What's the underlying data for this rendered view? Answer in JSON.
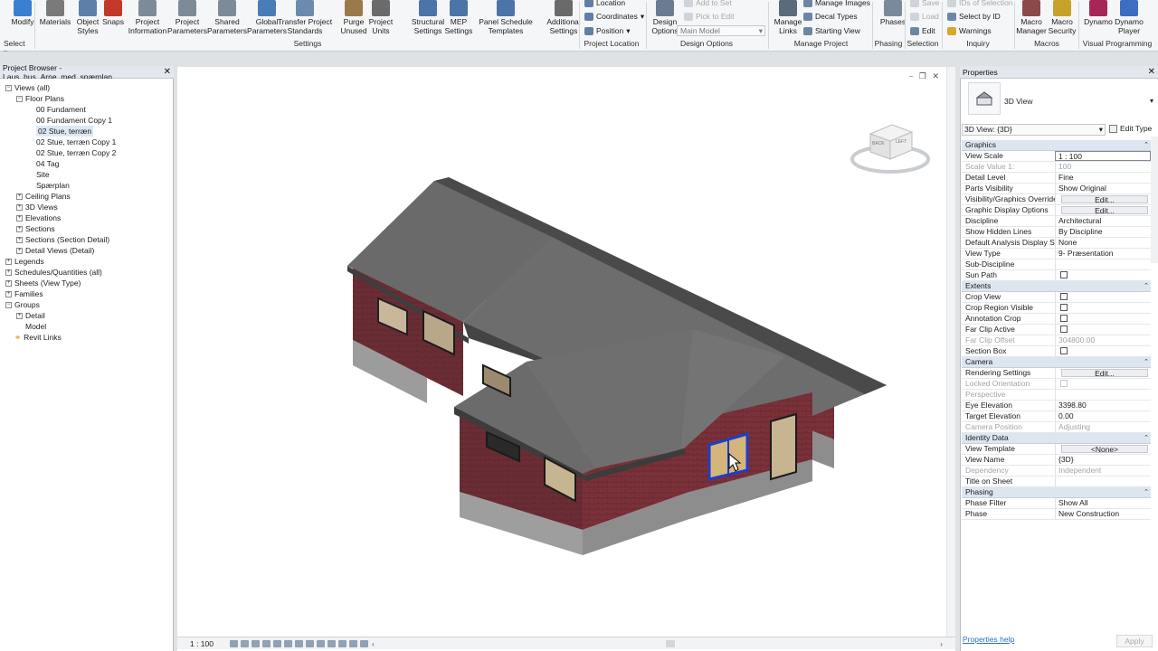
{
  "ribbon": {
    "buttons": [
      {
        "label": "Modify",
        "name": "modify-button",
        "icon": "cursor-icon",
        "color": "#3b7fd0"
      },
      {
        "label": "Materials",
        "name": "materials-button",
        "icon": "sphere-icon",
        "color": "#7a7a7a"
      },
      {
        "label": "Object Styles",
        "name": "object-styles-button",
        "icon": "object-styles-icon",
        "color": "#5d7fa8"
      },
      {
        "label": "Snaps",
        "name": "snaps-button",
        "icon": "magnet-icon",
        "color": "#c2392b"
      },
      {
        "label": "Project Information",
        "name": "project-information-button",
        "icon": "building-doc-icon",
        "color": "#7d8b99"
      },
      {
        "label": "Project Parameters",
        "name": "project-parameters-button",
        "icon": "parameters-icon",
        "color": "#7d8b99"
      },
      {
        "label": "Shared Parameters",
        "name": "shared-parameters-button",
        "icon": "shared-params-icon",
        "color": "#7d8b99"
      },
      {
        "label": "Global Parameters",
        "name": "global-parameters-button",
        "icon": "globe-icon",
        "color": "#4a7db8"
      },
      {
        "label": "Transfer Project Standards",
        "name": "transfer-standards-button",
        "icon": "transfer-icon",
        "color": "#6c8aad"
      },
      {
        "label": "Purge Unused",
        "name": "purge-unused-button",
        "icon": "purge-icon",
        "color": "#9a7a4a"
      },
      {
        "label": "Project Units",
        "name": "project-units-button",
        "icon": "units-icon",
        "color": "#6b6b6b"
      },
      {
        "label": "Structural Settings",
        "name": "structural-settings-button",
        "icon": "structural-icon",
        "color": "#4b74a8"
      },
      {
        "label": "MEP Settings",
        "name": "mep-settings-button",
        "icon": "mep-icon",
        "color": "#4b74a8"
      },
      {
        "label": "Panel Schedule Templates",
        "name": "panel-schedule-button",
        "icon": "panel-schedule-icon",
        "color": "#4b74a8"
      },
      {
        "label": "Additional Settings",
        "name": "additional-settings-button",
        "icon": "wrench-icon",
        "color": "#6a6a6a"
      },
      {
        "label": "Design Options",
        "name": "design-options-button",
        "icon": "design-options-icon",
        "color": "#6a7c90"
      },
      {
        "label": "Manage Links",
        "name": "manage-links-button",
        "icon": "link-icon",
        "color": "#5a6b7c"
      },
      {
        "label": "Phases",
        "name": "phases-button",
        "icon": "phases-icon",
        "color": "#7a8a9a"
      },
      {
        "label": "Macro Manager",
        "name": "macro-manager-button",
        "icon": "macro-icon",
        "color": "#8a4a4a"
      },
      {
        "label": "Macro Security",
        "name": "macro-security-button",
        "icon": "shield-icon",
        "color": "#c7a12a"
      },
      {
        "label": "Dynamo",
        "name": "dynamo-button",
        "icon": "dynamo-icon",
        "color": "#a8255a"
      },
      {
        "label": "Dynamo Player",
        "name": "dynamo-player-button",
        "icon": "dynamo-player-icon",
        "color": "#3d6ec0"
      }
    ],
    "small": {
      "location": "Location",
      "coordinates": "Coordinates",
      "position": "Position",
      "main_model": "Main Model",
      "add_to_set": "Add to Set",
      "pick_to_edit": "Pick to Edit",
      "manage_images": "Manage Images",
      "decal_types": "Decal Types",
      "starting_view": "Starting View",
      "save": "Save",
      "load": "Load",
      "edit": "Edit",
      "ids_of_selection": "IDs of Selection",
      "select_by_id": "Select by ID",
      "warnings": "Warnings"
    },
    "groups": {
      "select": "Select",
      "settings": "Settings",
      "project_location": "Project Location",
      "design_options": "Design Options",
      "manage_project": "Manage Project",
      "phasing": "Phasing",
      "selection": "Selection",
      "inquiry": "Inquiry",
      "macros": "Macros",
      "visual_programming": "Visual Programming"
    }
  },
  "project_browser": {
    "title": "Project Browser - Laus_hus_Arne_med_spærplan_...",
    "close": "✕",
    "items": [
      {
        "label": "Views (all)",
        "level": 0,
        "toggle": "−"
      },
      {
        "label": "Floor Plans",
        "level": 1,
        "toggle": "−"
      },
      {
        "label": "00 Fundament",
        "level": 2,
        "toggle": ""
      },
      {
        "label": "00 Fundament Copy 1",
        "level": 2,
        "toggle": ""
      },
      {
        "label": "02 Stue, terræn",
        "level": 2,
        "toggle": "",
        "selected": true
      },
      {
        "label": "02 Stue, terræn Copy 1",
        "level": 2,
        "toggle": ""
      },
      {
        "label": "02 Stue, terræn Copy 2",
        "level": 2,
        "toggle": ""
      },
      {
        "label": "04 Tag",
        "level": 2,
        "toggle": ""
      },
      {
        "label": "Site",
        "level": 2,
        "toggle": ""
      },
      {
        "label": "Spærplan",
        "level": 2,
        "toggle": ""
      },
      {
        "label": "Ceiling Plans",
        "level": 1,
        "toggle": "+"
      },
      {
        "label": "3D Views",
        "level": 1,
        "toggle": "+"
      },
      {
        "label": "Elevations",
        "level": 1,
        "toggle": "+"
      },
      {
        "label": "Sections",
        "level": 1,
        "toggle": "+"
      },
      {
        "label": "Sections (Section Detail)",
        "level": 1,
        "toggle": "+"
      },
      {
        "label": "Detail Views (Detail)",
        "level": 1,
        "toggle": "+"
      },
      {
        "label": "Legends",
        "level": 0,
        "toggle": "+"
      },
      {
        "label": "Schedules/Quantities (all)",
        "level": 0,
        "toggle": "+"
      },
      {
        "label": "Sheets (View Type)",
        "level": 0,
        "toggle": "+"
      },
      {
        "label": "Families",
        "level": 0,
        "toggle": "+"
      },
      {
        "label": "Groups",
        "level": 0,
        "toggle": "−"
      },
      {
        "label": "Detail",
        "level": 1,
        "toggle": "+"
      },
      {
        "label": "Model",
        "level": 1,
        "toggle": ""
      },
      {
        "label": "Revit Links",
        "level": 0,
        "toggle": "",
        "icon": "link-icon"
      }
    ]
  },
  "viewcube": {
    "face_back": "BACK",
    "face_left": "LEFT"
  },
  "viewport": {
    "scale": "1 : 100",
    "window_controls": "⎯ ❐ ✕"
  },
  "properties": {
    "title": "Properties",
    "close": "✕",
    "type_name": "3D View",
    "selector": "3D View: {3D}",
    "edit_type": "Edit Type",
    "rows": [
      {
        "type": "section",
        "label": "Graphics"
      },
      {
        "label": "View Scale",
        "value": "1 : 100",
        "kind": "input"
      },
      {
        "label": "Scale Value    1:",
        "value": "100",
        "dis": true
      },
      {
        "label": "Detail Level",
        "value": "Fine"
      },
      {
        "label": "Parts Visibility",
        "value": "Show Original"
      },
      {
        "label": "Visibility/Graphics Overrides",
        "value": "Edit...",
        "kind": "button"
      },
      {
        "label": "Graphic Display Options",
        "value": "Edit...",
        "kind": "button"
      },
      {
        "label": "Discipline",
        "value": "Architectural"
      },
      {
        "label": "Show Hidden Lines",
        "value": "By Discipline"
      },
      {
        "label": "Default Analysis Display St...",
        "value": "None"
      },
      {
        "label": "View Type",
        "value": "9- Præsentation"
      },
      {
        "label": "Sub-Discipline",
        "value": ""
      },
      {
        "label": "Sun Path",
        "value": "",
        "kind": "check"
      },
      {
        "type": "section",
        "label": "Extents"
      },
      {
        "label": "Crop View",
        "value": "",
        "kind": "check"
      },
      {
        "label": "Crop Region Visible",
        "value": "",
        "kind": "check"
      },
      {
        "label": "Annotation Crop",
        "value": "",
        "kind": "check"
      },
      {
        "label": "Far Clip Active",
        "value": "",
        "kind": "check"
      },
      {
        "label": "Far Clip Offset",
        "value": "304800.00",
        "dis": true
      },
      {
        "label": "Section Box",
        "value": "",
        "kind": "check"
      },
      {
        "type": "section",
        "label": "Camera"
      },
      {
        "label": "Rendering Settings",
        "value": "Edit...",
        "kind": "button"
      },
      {
        "label": "Locked Orientation",
        "value": "",
        "kind": "check",
        "dis": true
      },
      {
        "label": "Perspective",
        "value": "",
        "dis": true
      },
      {
        "label": "Eye Elevation",
        "value": "3398.80"
      },
      {
        "label": "Target Elevation",
        "value": "0.00"
      },
      {
        "label": "Camera Position",
        "value": "Adjusting",
        "dis": true
      },
      {
        "type": "section",
        "label": "Identity Data"
      },
      {
        "label": "View Template",
        "value": "<None>",
        "kind": "button"
      },
      {
        "label": "View Name",
        "value": "{3D}"
      },
      {
        "label": "Dependency",
        "value": "Independent",
        "dis": true
      },
      {
        "label": "Title on Sheet",
        "value": ""
      },
      {
        "type": "section",
        "label": "Phasing"
      },
      {
        "label": "Phase Filter",
        "value": "Show All"
      },
      {
        "label": "Phase",
        "value": "New Construction"
      }
    ],
    "help_link": "Properties help",
    "apply": "Apply"
  },
  "colors": {
    "brick": "#6e2f36",
    "roof": "#6b6b6b",
    "foundation": "#a6a6a6",
    "selection": "#1e3ec8",
    "accent": "#2f6fc2"
  }
}
